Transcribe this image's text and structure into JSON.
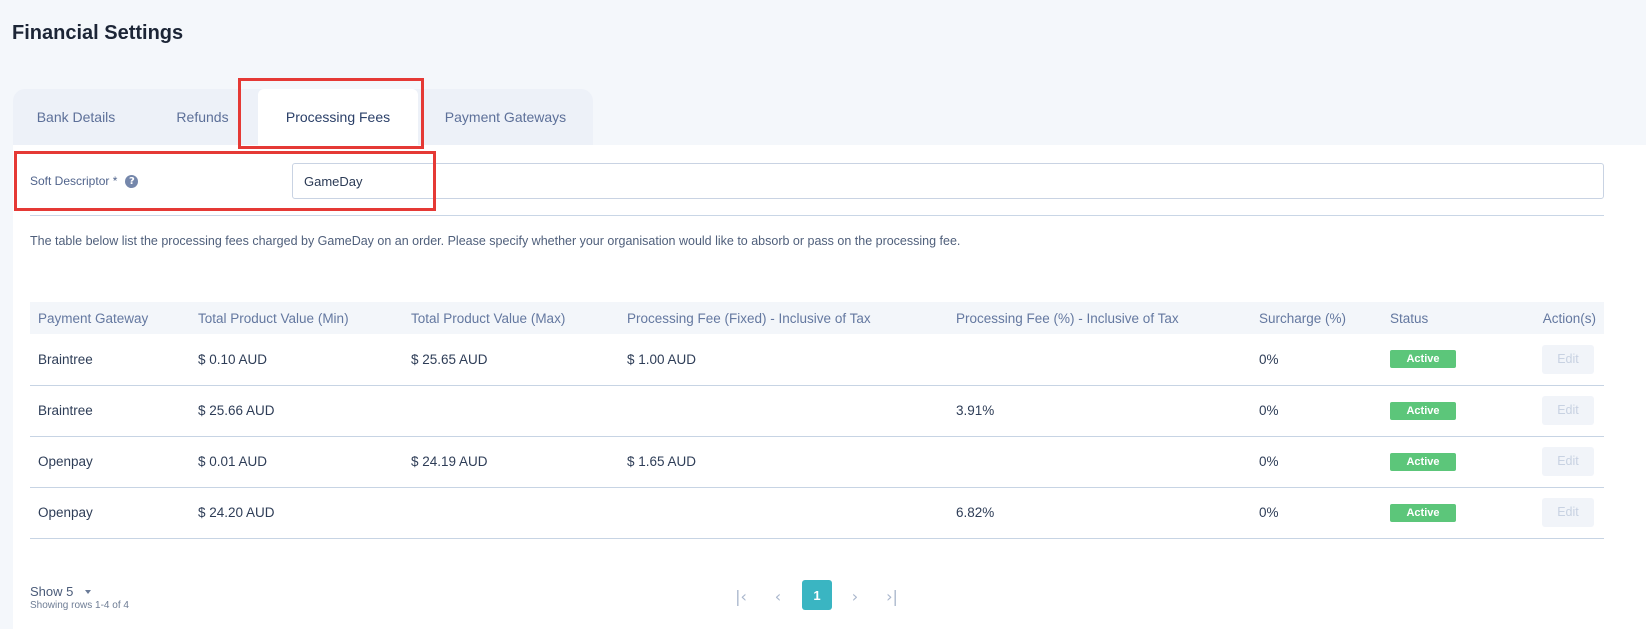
{
  "page": {
    "title": "Financial Settings"
  },
  "tabs": [
    {
      "label": "Bank Details",
      "active": false
    },
    {
      "label": "Refunds",
      "active": false
    },
    {
      "label": "Processing Fees",
      "active": true
    },
    {
      "label": "Payment Gateways",
      "active": false
    }
  ],
  "soft_descriptor": {
    "label": "Soft Descriptor *",
    "help_icon": "question-circle-icon",
    "value": "GameDay"
  },
  "description": "The table below list the processing fees charged by GameDay on an order. Please specify whether your organisation would like to absorb or pass on the processing fee.",
  "table": {
    "columns": [
      "Payment Gateway",
      "Total Product Value (Min)",
      "Total Product Value (Max)",
      "Processing Fee (Fixed) - Inclusive of Tax",
      "Processing Fee (%) - Inclusive of Tax",
      "Surcharge (%)",
      "Status",
      "Action(s)"
    ],
    "rows": [
      {
        "gateway": "Braintree",
        "min": "$ 0.10 AUD",
        "max": "$ 25.65 AUD",
        "fee_fixed": "$ 1.00 AUD",
        "fee_pct": "",
        "surcharge": "0%",
        "status": "Active",
        "action": "Edit"
      },
      {
        "gateway": "Braintree",
        "min": "$ 25.66 AUD",
        "max": "",
        "fee_fixed": "",
        "fee_pct": "3.91%",
        "surcharge": "0%",
        "status": "Active",
        "action": "Edit"
      },
      {
        "gateway": "Openpay",
        "min": "$ 0.01 AUD",
        "max": "$ 24.19 AUD",
        "fee_fixed": "$ 1.65 AUD",
        "fee_pct": "",
        "surcharge": "0%",
        "status": "Active",
        "action": "Edit"
      },
      {
        "gateway": "Openpay",
        "min": "$ 24.20 AUD",
        "max": "",
        "fee_fixed": "",
        "fee_pct": "6.82%",
        "surcharge": "0%",
        "status": "Active",
        "action": "Edit"
      }
    ]
  },
  "footer": {
    "show_label": "Show 5",
    "row_info": "Showing rows 1-4 of 4",
    "current_page": "1"
  },
  "colors": {
    "accent": "#3ab5c2",
    "status_active": "#5cc67a",
    "highlight": "#e53935"
  }
}
